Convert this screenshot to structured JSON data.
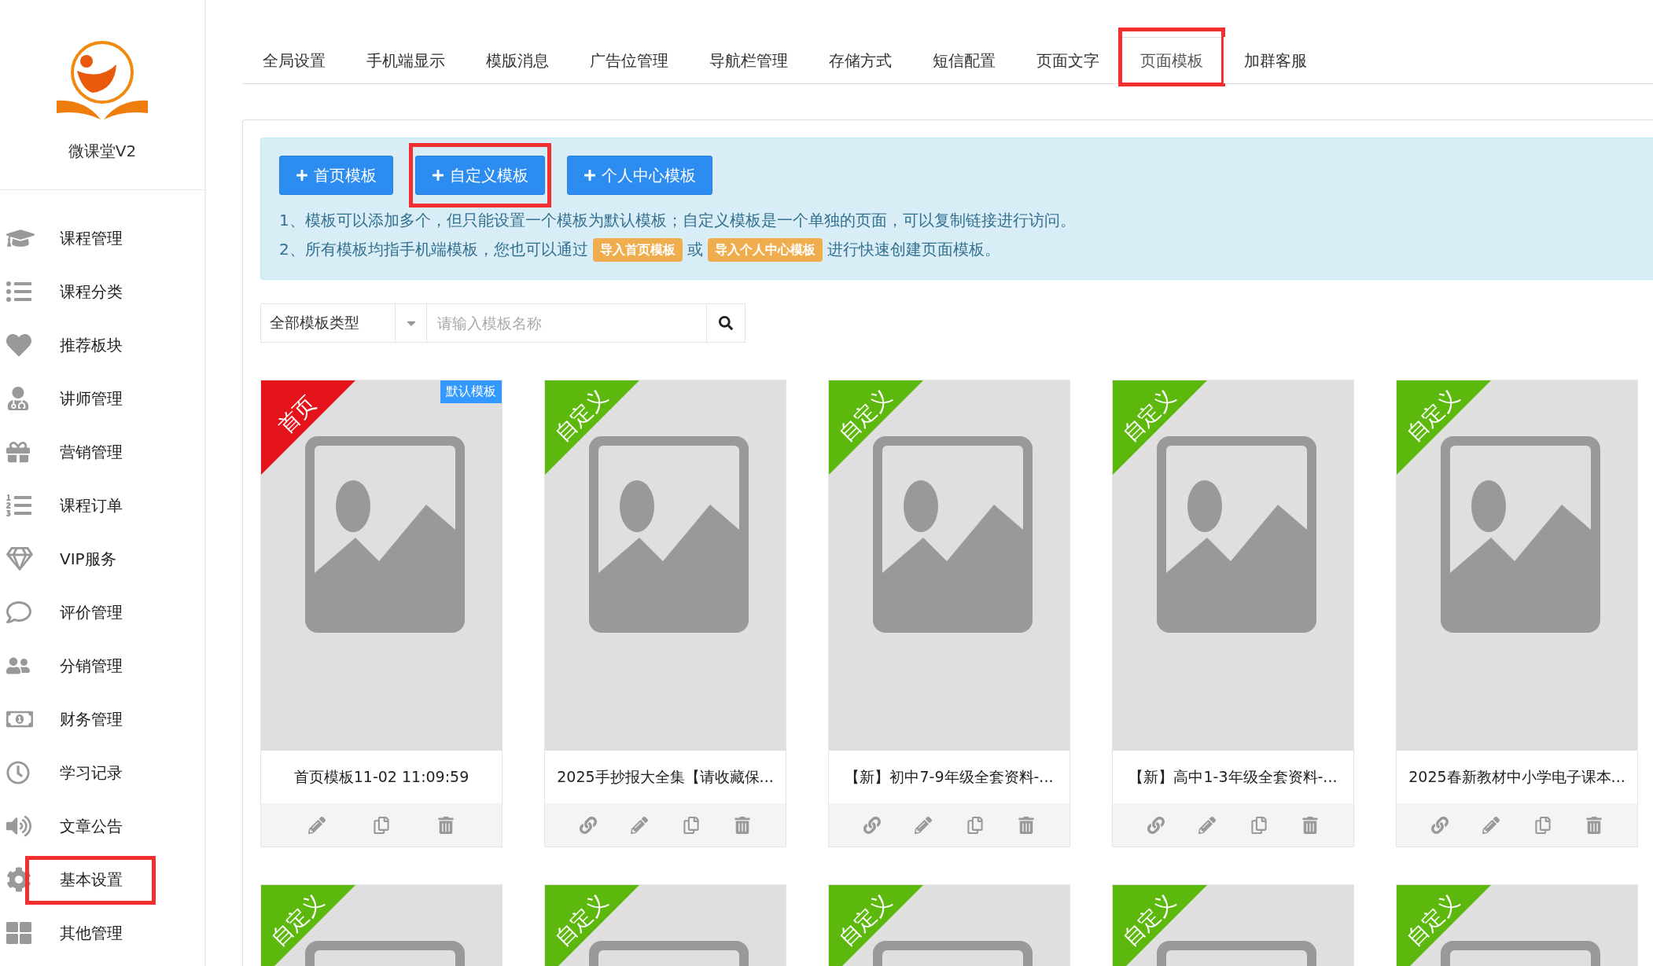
{
  "brand": {
    "name": "微课堂V2"
  },
  "sidebar": {
    "items": [
      {
        "label": "课程管理",
        "highlighted": false
      },
      {
        "label": "课程分类",
        "highlighted": false
      },
      {
        "label": "推荐板块",
        "highlighted": false
      },
      {
        "label": "讲师管理",
        "highlighted": false
      },
      {
        "label": "营销管理",
        "highlighted": false
      },
      {
        "label": "课程订单",
        "highlighted": false
      },
      {
        "label": "VIP服务",
        "highlighted": false
      },
      {
        "label": "评价管理",
        "highlighted": false
      },
      {
        "label": "分销管理",
        "highlighted": false
      },
      {
        "label": "财务管理",
        "highlighted": false
      },
      {
        "label": "学习记录",
        "highlighted": false
      },
      {
        "label": "文章公告",
        "highlighted": false
      },
      {
        "label": "基本设置",
        "highlighted": true
      },
      {
        "label": "其他管理",
        "highlighted": false
      }
    ]
  },
  "tabs": [
    {
      "label": "全局设置",
      "selected": false,
      "highlighted": false
    },
    {
      "label": "手机端显示",
      "selected": false,
      "highlighted": false
    },
    {
      "label": "模版消息",
      "selected": false,
      "highlighted": false
    },
    {
      "label": "广告位管理",
      "selected": false,
      "highlighted": false
    },
    {
      "label": "导航栏管理",
      "selected": false,
      "highlighted": false
    },
    {
      "label": "存储方式",
      "selected": false,
      "highlighted": false
    },
    {
      "label": "短信配置",
      "selected": false,
      "highlighted": false
    },
    {
      "label": "页面文字",
      "selected": false,
      "highlighted": false
    },
    {
      "label": "页面模板",
      "selected": true,
      "highlighted": true
    },
    {
      "label": "加群客服",
      "selected": false,
      "highlighted": false
    }
  ],
  "create_buttons": [
    {
      "label": "首页模板",
      "highlighted": false
    },
    {
      "label": "自定义模板",
      "highlighted": true
    },
    {
      "label": "个人中心模板",
      "highlighted": false
    }
  ],
  "notes": [
    {
      "parts": [
        {
          "kind": "text",
          "text": "1、模板可以添加多个，但只能设置一个模板为默认模板；自定义模板是一个单独的页面，可以复制链接进行访问。"
        }
      ]
    },
    {
      "parts": [
        {
          "kind": "text",
          "text": "2、所有模板均指手机端模板，您也可以通过"
        },
        {
          "kind": "badge",
          "text": "导入首页模板"
        },
        {
          "kind": "text",
          "text": "或"
        },
        {
          "kind": "badge",
          "text": "导入个人中心模板"
        },
        {
          "kind": "text",
          "text": "进行快速创建页面模板。"
        }
      ]
    }
  ],
  "filter": {
    "type_select": "全部模板类型",
    "search": {
      "placeholder": "请输入模板名称"
    }
  },
  "templates": [
    {
      "kind": "home",
      "ribbon": "首页",
      "badge": "默认模板",
      "title": "首页模板11-02 11:09:59"
    },
    {
      "kind": "custom",
      "ribbon": "自定义",
      "title": "2025手抄报大全集【请收藏保..."
    },
    {
      "kind": "custom",
      "ribbon": "自定义",
      "title": "【新】初中7-9年级全套资料-..."
    },
    {
      "kind": "custom",
      "ribbon": "自定义",
      "title": "【新】高中1-3年级全套资料-..."
    },
    {
      "kind": "custom",
      "ribbon": "自定义",
      "title": "2025春新教材中小学电子课本..."
    },
    {
      "kind": "custom",
      "ribbon": "自定义"
    },
    {
      "kind": "custom",
      "ribbon": "自定义"
    },
    {
      "kind": "custom",
      "ribbon": "自定义"
    },
    {
      "kind": "custom",
      "ribbon": "自定义"
    },
    {
      "kind": "custom",
      "ribbon": "自定义"
    }
  ]
}
